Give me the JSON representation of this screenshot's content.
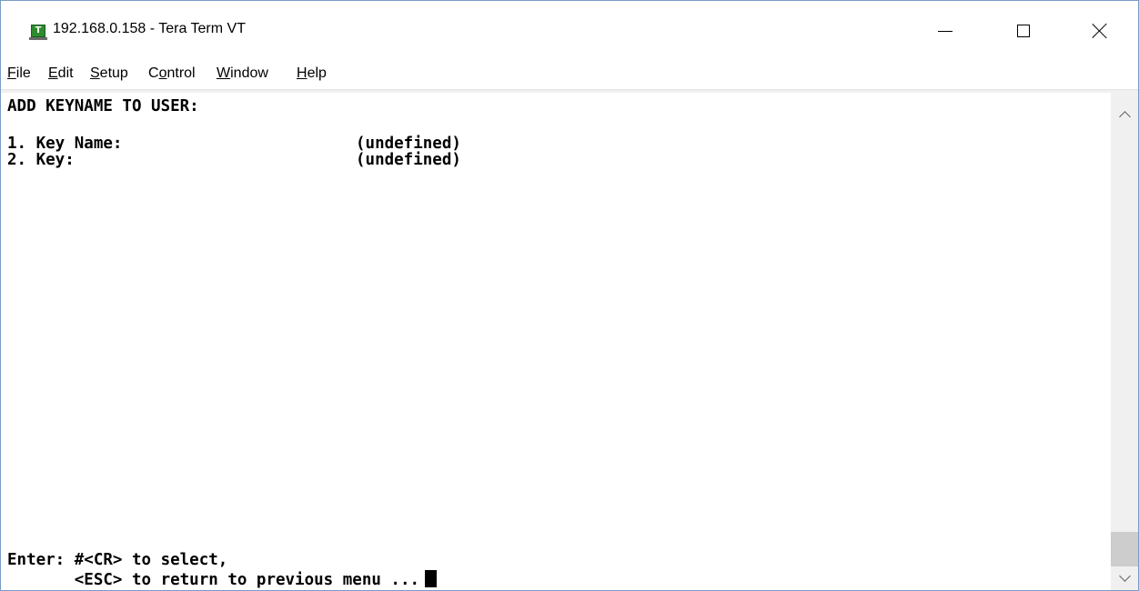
{
  "window": {
    "title": "192.168.0.158 - Tera Term VT",
    "app_icon_letter": "T"
  },
  "menu": [
    {
      "accel": "F",
      "rest": "ile"
    },
    {
      "accel": "E",
      "rest": "dit"
    },
    {
      "accel": "S",
      "rest": "etup"
    },
    {
      "pre": "C",
      "accel": "o",
      "rest": "ntrol"
    },
    {
      "accel": "W",
      "rest": "indow"
    },
    {
      "accel": "H",
      "rest": "elp"
    }
  ],
  "terminal": {
    "heading": "ADD KEYNAME TO USER:",
    "items": [
      {
        "label": "1. Key Name:",
        "value": "(undefined)"
      },
      {
        "label": "2. Key:",
        "value": "(undefined)"
      }
    ],
    "prompt_line1": "Enter: #<CR> to select,",
    "prompt_line2": "       <ESC> to return to previous menu ..."
  },
  "icons": {
    "minimize": "minimize-icon",
    "maximize": "maximize-icon",
    "close": "close-icon",
    "scroll_up": "chevron-up-icon",
    "scroll_down": "chevron-down-icon"
  }
}
